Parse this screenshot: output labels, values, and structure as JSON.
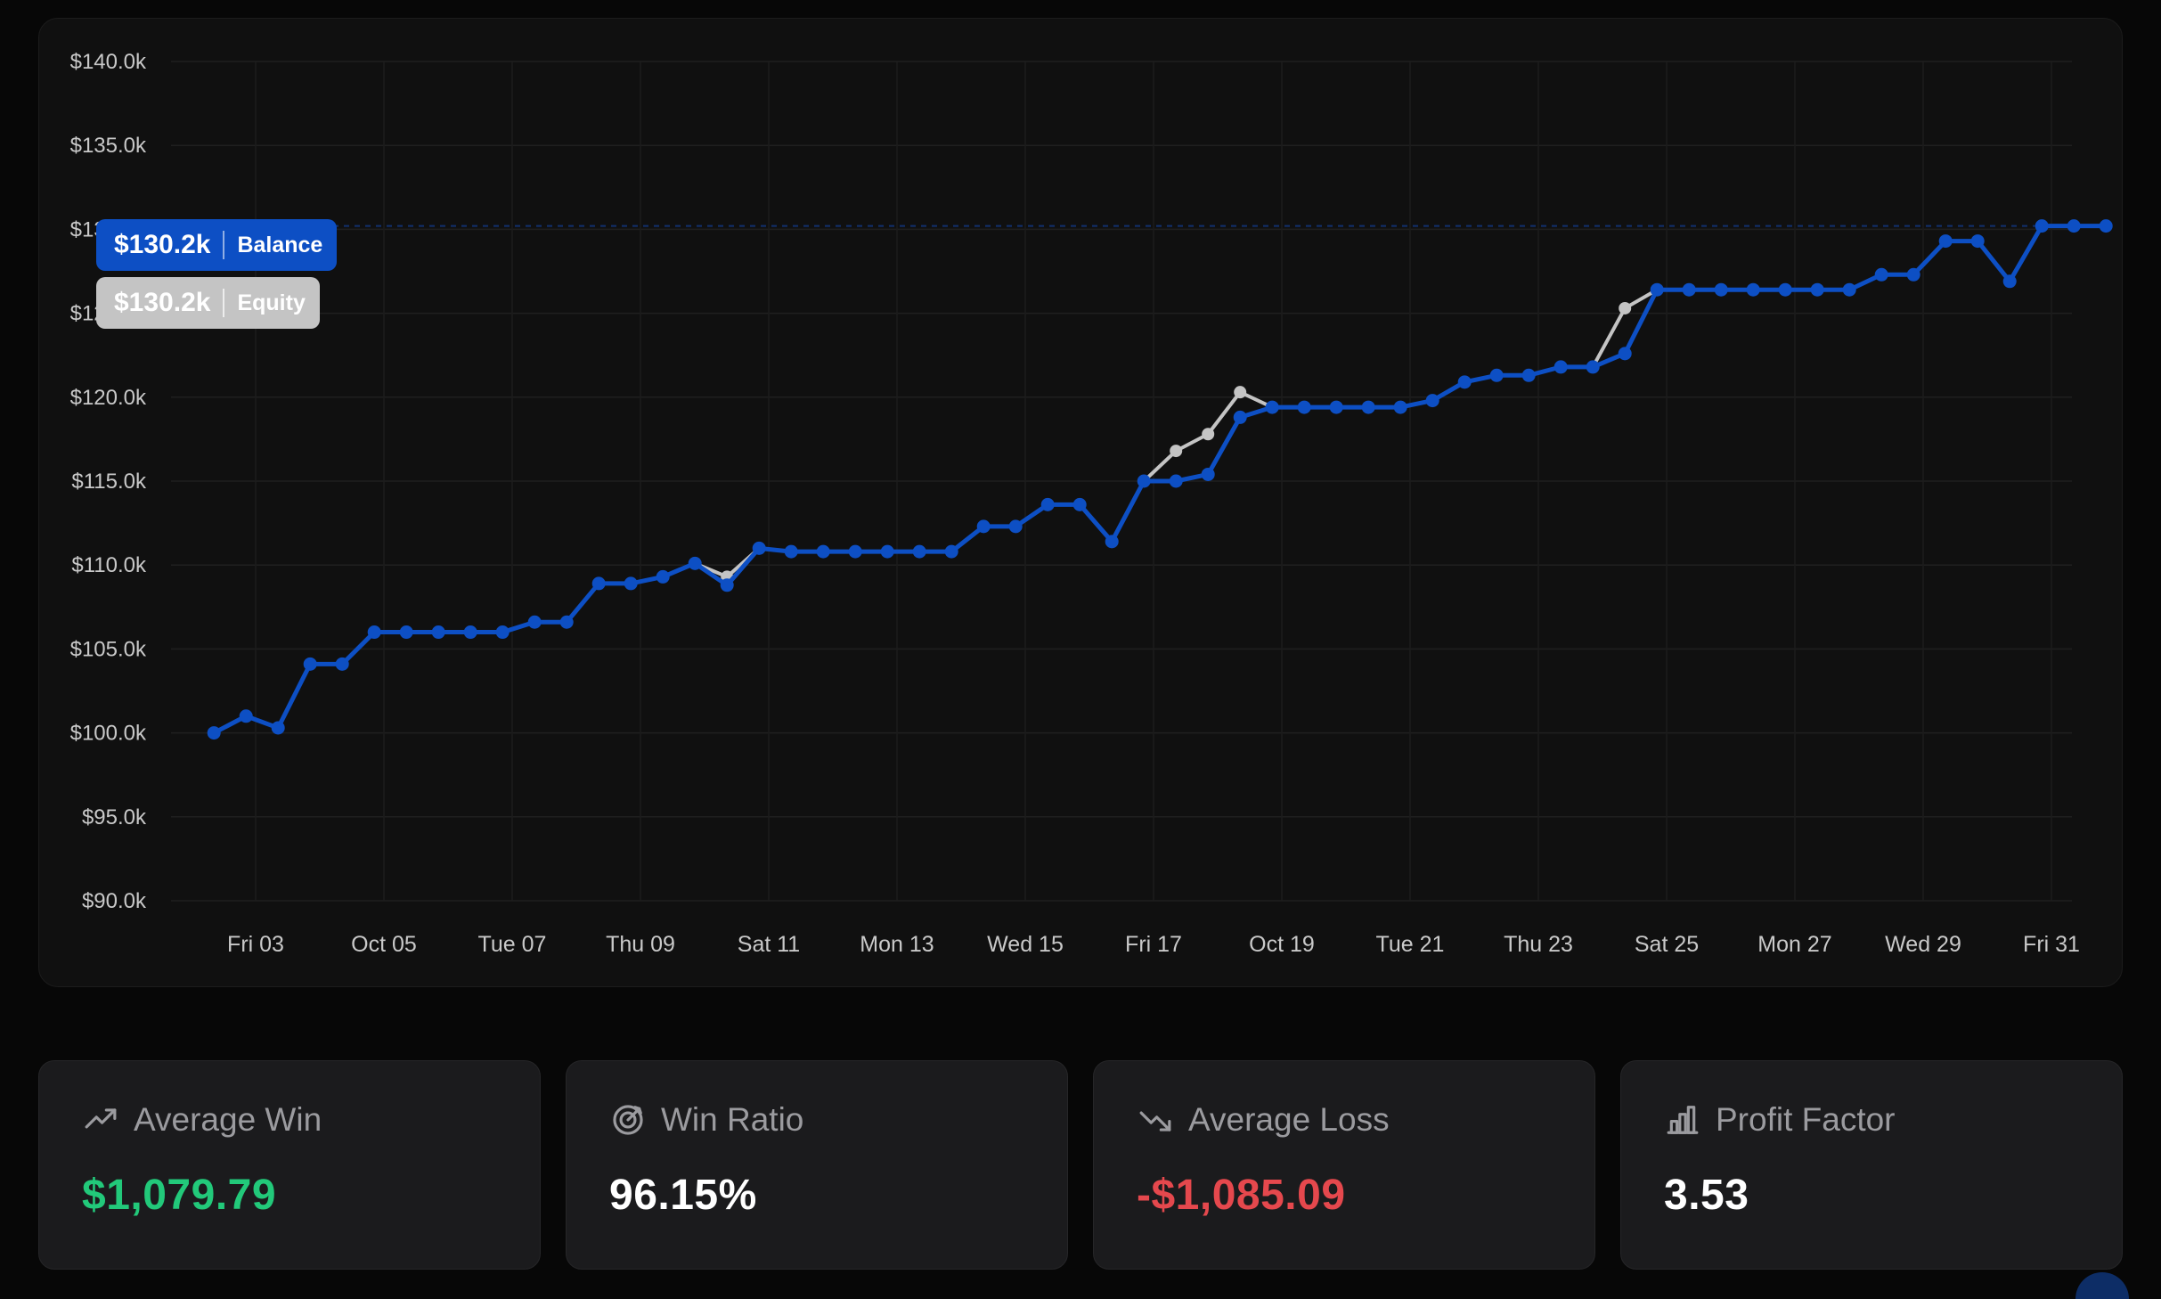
{
  "chart_data": {
    "type": "line",
    "y_ticks": [
      "$140.0k",
      "$135.0k",
      "$130.0k",
      "$125.0k",
      "$120.0k",
      "$115.0k",
      "$110.0k",
      "$105.0k",
      "$100.0k",
      "$95.0k",
      "$90.0k"
    ],
    "x_tick_labels": [
      "Fri 03",
      "Oct 05",
      "Tue 07",
      "Thu 09",
      "Sat 11",
      "Mon 13",
      "Wed 15",
      "Fri 17",
      "Oct 19",
      "Tue 21",
      "Thu 23",
      "Sat 25",
      "Mon 27",
      "Wed 29",
      "Fri 31"
    ],
    "ylim": [
      90,
      140
    ],
    "y_unit": "thousands USD",
    "x_range_days": [
      2.35,
      31.2
    ],
    "grid": true,
    "series": [
      {
        "name": "Balance",
        "color": "#0d4fc4",
        "points": [
          [
            2.35,
            100.0
          ],
          [
            2.85,
            101.0
          ],
          [
            3.35,
            100.3
          ],
          [
            3.85,
            104.1
          ],
          [
            4.35,
            104.1
          ],
          [
            4.85,
            106.0
          ],
          [
            5.35,
            106.0
          ],
          [
            5.85,
            106.0
          ],
          [
            6.35,
            106.0
          ],
          [
            6.85,
            106.0
          ],
          [
            7.35,
            106.6
          ],
          [
            7.85,
            106.6
          ],
          [
            8.35,
            108.9
          ],
          [
            8.85,
            108.9
          ],
          [
            9.35,
            109.3
          ],
          [
            9.85,
            110.1
          ],
          [
            10.35,
            108.8
          ],
          [
            10.85,
            111.0
          ],
          [
            11.35,
            110.8
          ],
          [
            11.85,
            110.8
          ],
          [
            12.35,
            110.8
          ],
          [
            12.85,
            110.8
          ],
          [
            13.35,
            110.8
          ],
          [
            13.85,
            110.8
          ],
          [
            14.35,
            112.3
          ],
          [
            14.85,
            112.3
          ],
          [
            15.35,
            113.6
          ],
          [
            15.85,
            113.6
          ],
          [
            16.35,
            111.4
          ],
          [
            16.85,
            115.0
          ],
          [
            17.35,
            115.0
          ],
          [
            17.85,
            115.4
          ],
          [
            18.35,
            118.8
          ],
          [
            18.85,
            119.4
          ],
          [
            19.35,
            119.4
          ],
          [
            19.85,
            119.4
          ],
          [
            20.35,
            119.4
          ],
          [
            20.85,
            119.4
          ],
          [
            21.35,
            119.8
          ],
          [
            21.85,
            120.9
          ],
          [
            22.35,
            121.3
          ],
          [
            22.85,
            121.3
          ],
          [
            23.35,
            121.8
          ],
          [
            23.85,
            121.8
          ],
          [
            24.35,
            122.6
          ],
          [
            24.85,
            126.4
          ],
          [
            25.35,
            126.4
          ],
          [
            25.85,
            126.4
          ],
          [
            26.35,
            126.4
          ],
          [
            26.85,
            126.4
          ],
          [
            27.35,
            126.4
          ],
          [
            27.85,
            126.4
          ],
          [
            28.35,
            127.3
          ],
          [
            28.85,
            127.3
          ],
          [
            29.35,
            129.3
          ],
          [
            29.85,
            129.3
          ],
          [
            30.35,
            126.9
          ],
          [
            30.85,
            130.2
          ],
          [
            31.35,
            130.2
          ],
          [
            31.85,
            130.2
          ]
        ]
      },
      {
        "name": "Equity",
        "color": "#c4c4c4",
        "points": [
          [
            9.35,
            109.3
          ],
          [
            9.85,
            110.1
          ],
          [
            10.35,
            109.3
          ],
          [
            10.85,
            111.0
          ],
          [
            16.85,
            115.0
          ],
          [
            17.35,
            116.8
          ],
          [
            17.85,
            117.8
          ],
          [
            18.35,
            120.3
          ],
          [
            18.85,
            119.4
          ],
          [
            23.85,
            121.8
          ],
          [
            24.35,
            125.3
          ],
          [
            24.85,
            126.4
          ]
        ]
      }
    ]
  },
  "current_values": {
    "balance": {
      "value": "$130.2k",
      "label": "Balance"
    },
    "equity": {
      "value": "$130.2k",
      "label": "Equity"
    }
  },
  "stats": [
    {
      "icon": "trending-up-icon",
      "label": "Average Win",
      "value": "$1,079.79",
      "color": "#22c97a"
    },
    {
      "icon": "target-icon",
      "label": "Win Ratio",
      "value": "96.15%",
      "color": "#ffffff"
    },
    {
      "icon": "trending-down-icon",
      "label": "Average Loss",
      "value": "-$1,085.09",
      "color": "#e5484d"
    },
    {
      "icon": "bar-chart-icon",
      "label": "Profit Factor",
      "value": "3.53",
      "color": "#ffffff"
    }
  ]
}
